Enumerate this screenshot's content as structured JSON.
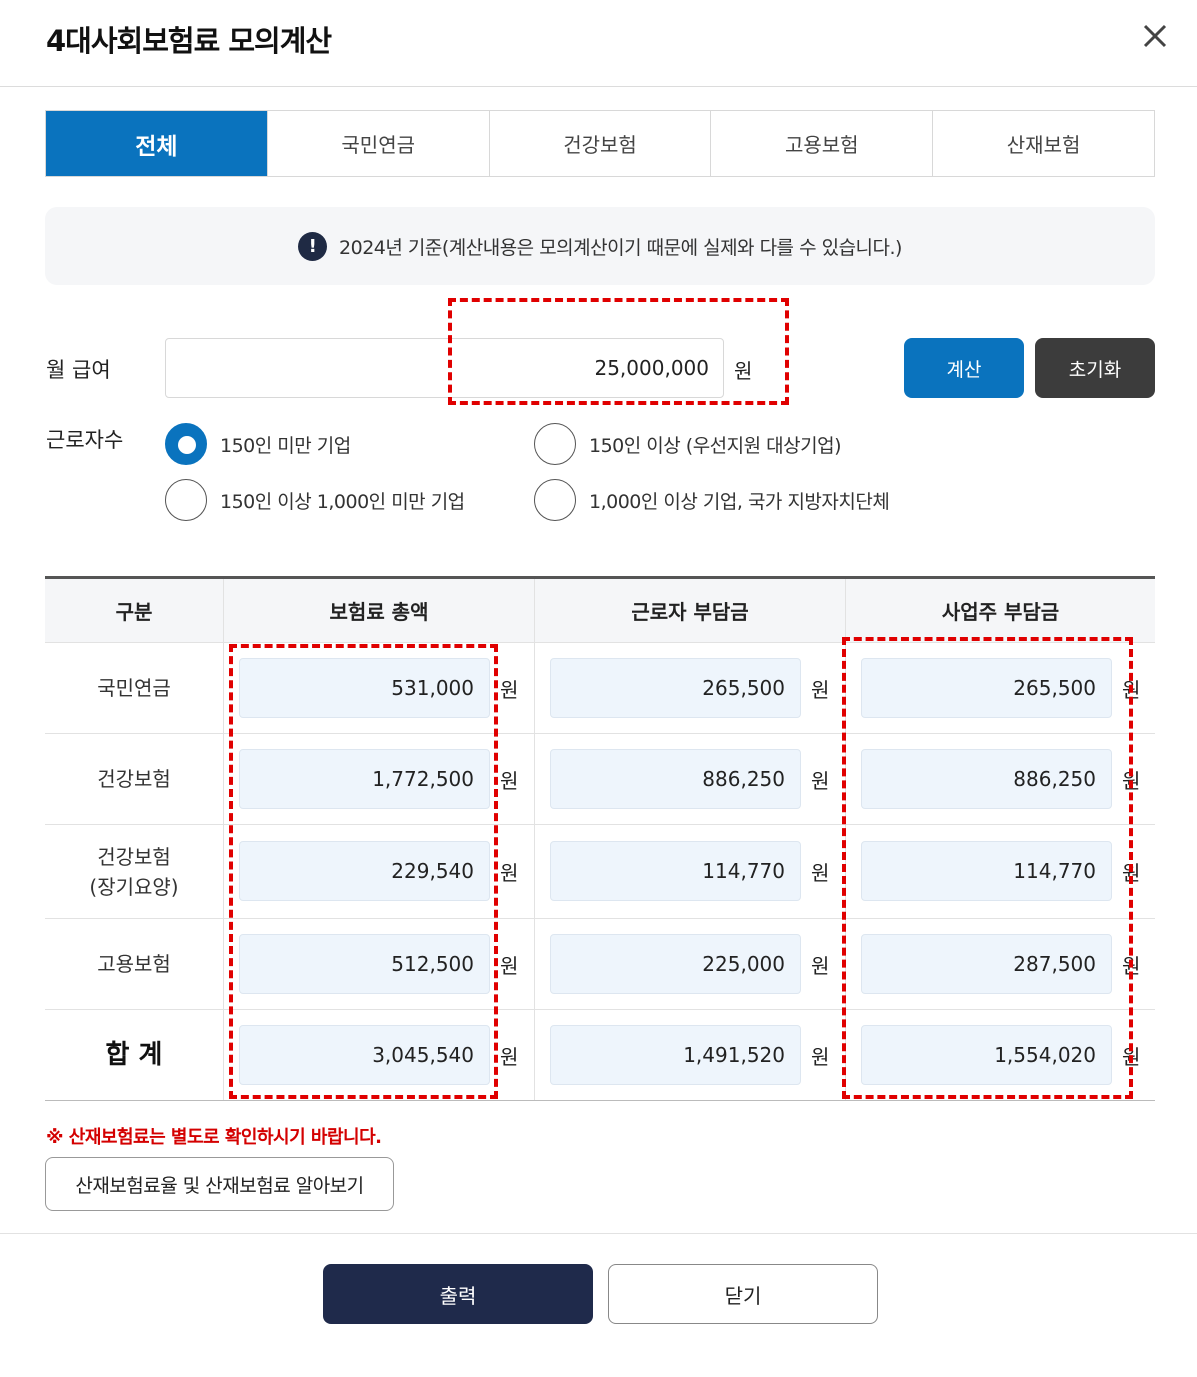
{
  "dialog": {
    "title": "4대사회보험료 모의계산",
    "close_icon": "close-icon"
  },
  "tabs": [
    {
      "label": "전체",
      "active": true
    },
    {
      "label": "국민연금",
      "active": false
    },
    {
      "label": "건강보험",
      "active": false
    },
    {
      "label": "고용보험",
      "active": false
    },
    {
      "label": "산재보험",
      "active": false
    }
  ],
  "notice": {
    "icon": "exclamation-icon",
    "text": "2024년 기준(계산내용은 모의계산이기 때문에 실제와 다를 수 있습니다.)"
  },
  "salary": {
    "label": "월 급여",
    "value": "25,000,000",
    "unit": "원"
  },
  "buttons": {
    "calculate": "계산",
    "reset": "초기화"
  },
  "workers": {
    "label": "근로자수",
    "options": [
      {
        "label": "150인 미만 기업",
        "selected": true
      },
      {
        "label": "150인 이상 (우선지원 대상기업)",
        "selected": false
      },
      {
        "label": "150인 이상 1,000인 미만 기업",
        "selected": false
      },
      {
        "label": "1,000인 이상 기업, 국가 지방자치단체",
        "selected": false
      }
    ]
  },
  "table": {
    "headers": [
      "구분",
      "보험료 총액",
      "근로자 부담금",
      "사업주 부담금"
    ],
    "unit": "원",
    "rows": [
      {
        "label": "국민연금",
        "total": "531,000",
        "employee": "265,500",
        "employer": "265,500"
      },
      {
        "label": "건강보험",
        "total": "1,772,500",
        "employee": "886,250",
        "employer": "886,250"
      },
      {
        "label": "건강보험\n(장기요양)",
        "total": "229,540",
        "employee": "114,770",
        "employer": "114,770"
      },
      {
        "label": "고용보험",
        "total": "512,500",
        "employee": "225,000",
        "employer": "287,500"
      },
      {
        "label": "합 계",
        "total": "3,045,540",
        "employee": "1,491,520",
        "employer": "1,554,020"
      }
    ]
  },
  "warning": "※ 산재보험료는 별도로 확인하시기 바랍니다.",
  "link_button": "산재보험료율 및 산재보험료 알아보기",
  "footer": {
    "print": "출력",
    "close": "닫기"
  },
  "colors": {
    "accent": "#0a73be",
    "dark_button": "#3c3c3c",
    "print_button": "#1f2a4b",
    "warning": "#d40000",
    "highlight_dash": "#e00000",
    "value_box": "#eef5fc"
  }
}
